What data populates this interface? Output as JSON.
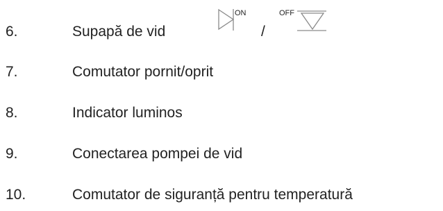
{
  "items": [
    {
      "number": "6.",
      "text": "Supapă de vid",
      "symbol": {
        "on_label": "ON",
        "separator": "/",
        "off_label": "OFF",
        "on_icon": "triangle-valve-right-icon",
        "off_icon": "triangle-valve-down-icon"
      }
    },
    {
      "number": "7.",
      "text": "Comutator pornit/oprit"
    },
    {
      "number": "8.",
      "text": "Indicator luminos"
    },
    {
      "number": "9.",
      "text": "Conectarea pompei de vid"
    },
    {
      "number": "10.",
      "text": "Comutator de siguranță pentru temperatură"
    }
  ]
}
